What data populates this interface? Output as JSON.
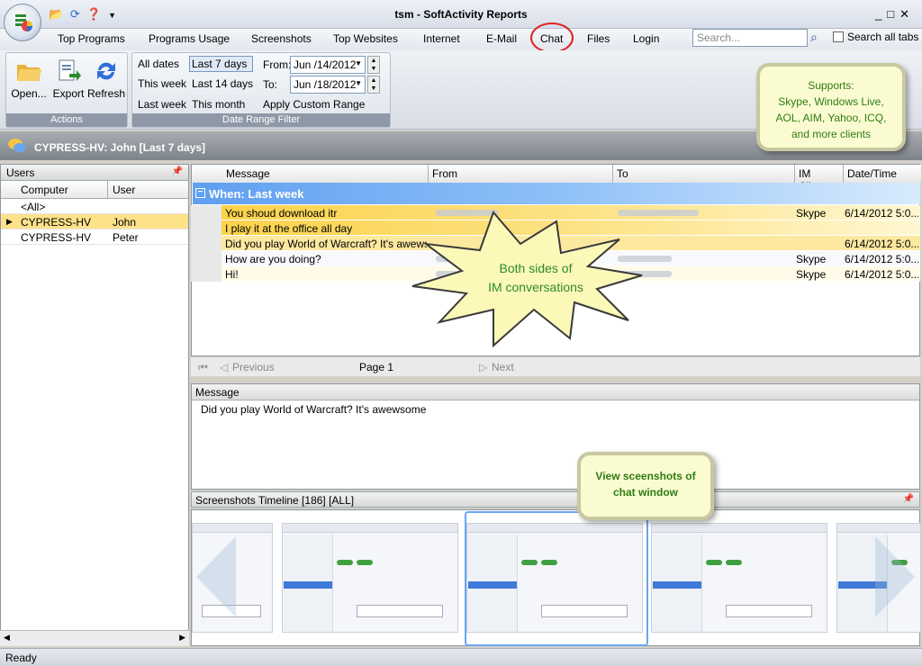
{
  "window": {
    "title": "tsm - SoftActivity Reports"
  },
  "qat": {
    "open_icon": "folder-open-icon",
    "refresh_icon": "refresh-icon",
    "help_icon": "help-icon",
    "menu_icon": "dropdown-arrow-icon"
  },
  "tabs": [
    {
      "label": "Top Programs"
    },
    {
      "label": "Programs Usage"
    },
    {
      "label": "Screenshots"
    },
    {
      "label": "Top Websites"
    },
    {
      "label": "Internet"
    },
    {
      "label": "E-Mail"
    },
    {
      "label": "Chat"
    },
    {
      "label": "Files"
    },
    {
      "label": "Login"
    }
  ],
  "search": {
    "placeholder": "Search...",
    "search_all_label": "Search all tabs"
  },
  "ribbon": {
    "actions": {
      "group_label": "Actions",
      "open": "Open...",
      "export": "Export",
      "refresh": "Refresh"
    },
    "date": {
      "group_label": "Date Range Filter",
      "all_dates": "All dates",
      "last_7": "Last 7 days",
      "this_week": "This week",
      "last_14": "Last 14 days",
      "last_week": "Last week",
      "this_month": "This month",
      "from_label": "From:",
      "from_value": "Jun /14/2012",
      "to_label": "To:",
      "to_value": "Jun /18/2012",
      "apply": "Apply Custom Range"
    }
  },
  "callouts": {
    "supports": {
      "line1": "Supports:",
      "line2": "Skype, Windows Live,",
      "line3": "AOL, AIM, Yahoo, ICQ,",
      "line4": "and more clients"
    },
    "both_sides": {
      "line1": "Both sides of",
      "line2": "IM conversations"
    },
    "screenshots": {
      "line1": "View sceenshots of",
      "line2": "chat window"
    }
  },
  "section": {
    "title": "CYPRESS-HV: John [Last 7 days]"
  },
  "users": {
    "panel_title": "Users",
    "columns": {
      "computer": "Computer",
      "user": "User"
    },
    "rows": [
      {
        "computer": "<All>",
        "user": ""
      },
      {
        "computer": "CYPRESS-HV",
        "user": "John"
      },
      {
        "computer": "CYPRESS-HV",
        "user": "Peter"
      }
    ]
  },
  "messages": {
    "columns": {
      "message": "Message",
      "from": "From",
      "to": "To",
      "client": "IM Client",
      "datetime": "Date/Time"
    },
    "group": "When: Last week",
    "rows": [
      {
        "message": "You shoud download itr",
        "client": "Skype",
        "datetime": "6/14/2012 5:0..."
      },
      {
        "message": "I play it at the office all day",
        "client": "",
        "datetime": ""
      },
      {
        "message": "Did you play World of Warcraft? It's awewso...",
        "client": "",
        "datetime": "6/14/2012 5:0..."
      },
      {
        "message": "How are you doing?",
        "client": "Skype",
        "datetime": "6/14/2012 5:0..."
      },
      {
        "message": "Hi!",
        "client": "Skype",
        "datetime": "6/14/2012 5:0..."
      }
    ]
  },
  "pager": {
    "previous": "Previous",
    "page": "Page 1",
    "next": "Next"
  },
  "message_panel": {
    "title": "Message",
    "text": "Did you play World of Warcraft? It's awewsome"
  },
  "timeline": {
    "title": "Screenshots Timeline [186] [ALL]"
  },
  "status": {
    "text": "Ready"
  }
}
